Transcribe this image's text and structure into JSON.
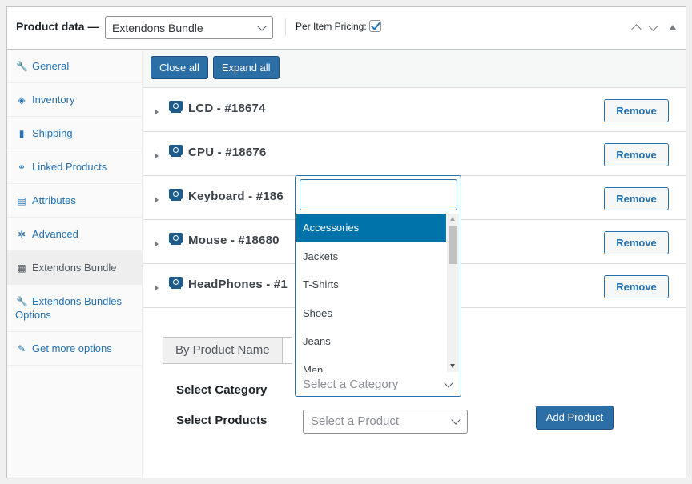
{
  "header": {
    "title": "Product data —",
    "product_type": "Extendons Bundle",
    "per_item_pricing_label": "Per Item Pricing:",
    "per_item_pricing_checked": true
  },
  "sidebar": {
    "items": [
      {
        "label": "General",
        "icon": "wrench-icon",
        "glyph": "🔧"
      },
      {
        "label": "Inventory",
        "icon": "tag-icon",
        "glyph": "◈"
      },
      {
        "label": "Shipping",
        "icon": "truck-icon",
        "glyph": "▮"
      },
      {
        "label": "Linked Products",
        "icon": "link-icon",
        "glyph": "⚭"
      },
      {
        "label": "Attributes",
        "icon": "list-icon",
        "glyph": "▤"
      },
      {
        "label": "Advanced",
        "icon": "gear-icon",
        "glyph": "✲"
      },
      {
        "label": "Extendons Bundle",
        "icon": "grid-icon",
        "glyph": "▦"
      },
      {
        "label": "Extendons Bundles Options",
        "icon": "wrench-icon",
        "glyph": "🔧"
      },
      {
        "label": "Get more options",
        "icon": "plugin-icon",
        "glyph": "✎"
      }
    ]
  },
  "toolbar": {
    "close_all": "Close all",
    "expand_all": "Expand all"
  },
  "bundle_items": [
    {
      "name": "LCD - #18674",
      "remove": "Remove"
    },
    {
      "name": "CPU - #18676",
      "remove": "Remove"
    },
    {
      "name": "Keyboard - #186",
      "remove": "Remove"
    },
    {
      "name": "Mouse - #18680",
      "remove": "Remove"
    },
    {
      "name": "HeadPhones - #1",
      "remove": "Remove"
    }
  ],
  "search_tabs": {
    "by_product_name": "By Product Name"
  },
  "form": {
    "category_label": "Select Category",
    "category_placeholder": "Select a Category",
    "products_label": "Select Products",
    "products_placeholder": "Select a Product",
    "add_product": "Add Product"
  },
  "category_dropdown": {
    "search_value": "",
    "options": [
      "Accessories",
      "Jackets",
      "T-Shirts",
      "Shoes",
      "Jeans",
      "Men"
    ],
    "highlighted": "Accessories"
  }
}
